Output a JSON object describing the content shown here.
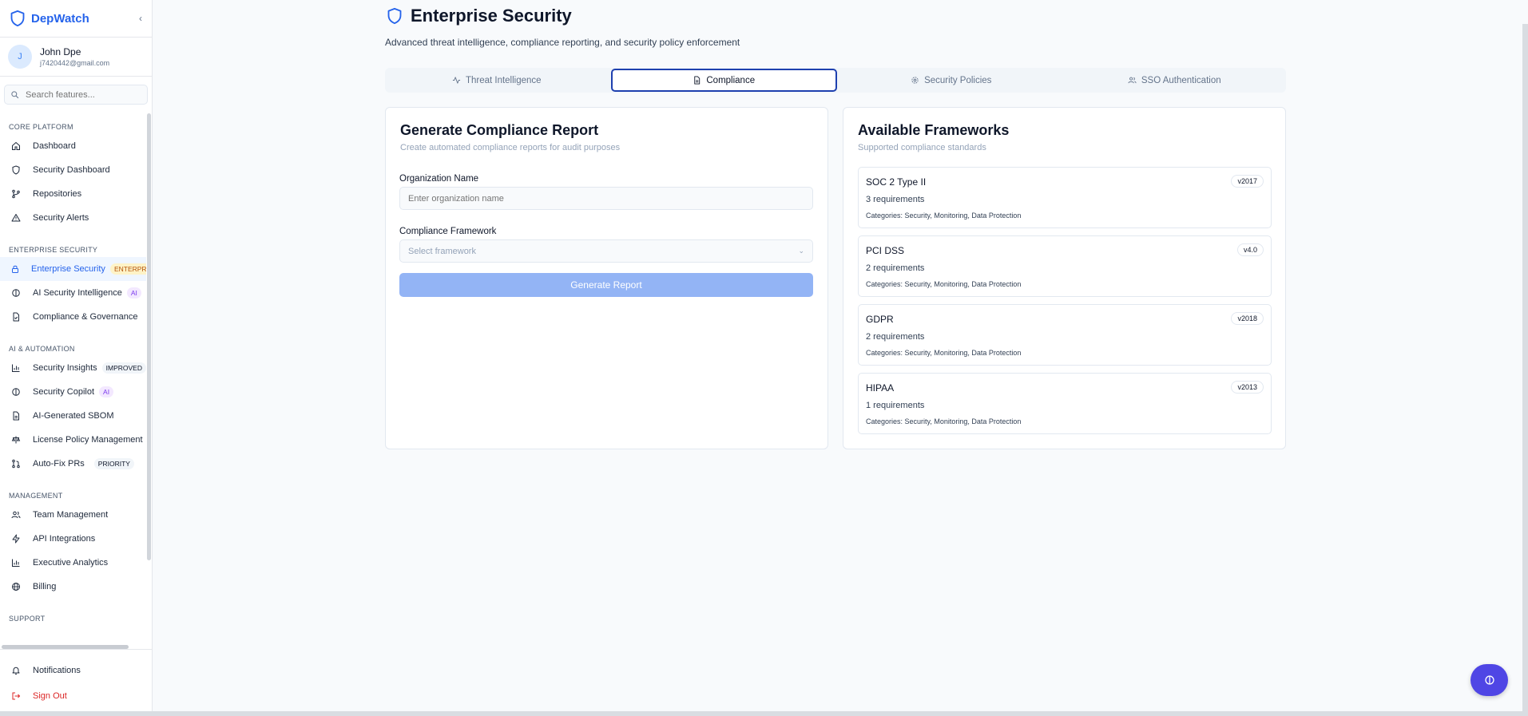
{
  "app": {
    "name": "DepWatch",
    "brand_color": "#2563eb"
  },
  "user": {
    "initial": "J",
    "name": "John Dpe",
    "email": "j7420442@gmail.com"
  },
  "search": {
    "placeholder": "Search features..."
  },
  "sidebar": {
    "sections": [
      {
        "title": "CORE PLATFORM",
        "items": [
          {
            "label": "Dashboard",
            "icon": "home-icon"
          },
          {
            "label": "Security Dashboard",
            "icon": "shield-icon"
          },
          {
            "label": "Repositories",
            "icon": "git-branch-icon"
          },
          {
            "label": "Security Alerts",
            "icon": "alert-triangle-icon"
          }
        ]
      },
      {
        "title": "ENTERPRISE SECURITY",
        "items": [
          {
            "label": "Enterprise Security",
            "icon": "lock-icon",
            "badge": "ENTERPRISE",
            "active": true
          },
          {
            "label": "AI Security Intelligence",
            "icon": "brain-icon",
            "badge": "AI"
          },
          {
            "label": "Compliance & Governance",
            "icon": "file-check-icon"
          }
        ]
      },
      {
        "title": "AI & AUTOMATION",
        "items": [
          {
            "label": "Security Insights",
            "icon": "bar-chart-icon",
            "badge": "IMPROVED"
          },
          {
            "label": "Security Copilot",
            "icon": "brain-icon",
            "badge": "AI"
          },
          {
            "label": "AI-Generated SBOM",
            "icon": "file-text-icon"
          },
          {
            "label": "License Policy Management",
            "icon": "scale-icon"
          },
          {
            "label": "Auto-Fix PRs",
            "icon": "git-pull-request-icon",
            "badge": "PRIORITY"
          }
        ]
      },
      {
        "title": "MANAGEMENT",
        "items": [
          {
            "label": "Team Management",
            "icon": "users-icon"
          },
          {
            "label": "API Integrations",
            "icon": "zap-icon"
          },
          {
            "label": "Executive Analytics",
            "icon": "bar-chart-icon"
          },
          {
            "label": "Billing",
            "icon": "globe-icon"
          }
        ]
      },
      {
        "title": "SUPPORT",
        "items": []
      }
    ],
    "bottom": {
      "notifications": "Notifications",
      "sign_out": "Sign Out"
    }
  },
  "page": {
    "title": "Enterprise Security",
    "subtitle": "Advanced threat intelligence, compliance reporting, and security policy enforcement",
    "tabs": [
      {
        "label": "Threat Intelligence",
        "icon": "activity-icon"
      },
      {
        "label": "Compliance",
        "icon": "file-text-icon",
        "active": true
      },
      {
        "label": "Security Policies",
        "icon": "gear-icon"
      },
      {
        "label": "SSO Authentication",
        "icon": "users-icon"
      }
    ]
  },
  "report": {
    "title": "Generate Compliance Report",
    "description": "Create automated compliance reports for audit purposes",
    "org_label": "Organization Name",
    "org_placeholder": "Enter organization name",
    "org_value": "",
    "framework_label": "Compliance Framework",
    "framework_placeholder": "Select framework",
    "button": "Generate Report"
  },
  "frameworks": {
    "title": "Available Frameworks",
    "description": "Supported compliance standards",
    "items": [
      {
        "name": "SOC 2 Type II",
        "version": "v2017",
        "requirements": "3 requirements",
        "categories": "Categories: Security, Monitoring, Data Protection"
      },
      {
        "name": "PCI DSS",
        "version": "v4.0",
        "requirements": "2 requirements",
        "categories": "Categories: Security, Monitoring, Data Protection"
      },
      {
        "name": "GDPR",
        "version": "v2018",
        "requirements": "2 requirements",
        "categories": "Categories: Security, Monitoring, Data Protection"
      },
      {
        "name": "HIPAA",
        "version": "v2013",
        "requirements": "1 requirements",
        "categories": "Categories: Security, Monitoring, Data Protection"
      }
    ]
  },
  "colors": {
    "accent": "#2563eb",
    "fab": "#4f46e5",
    "button_disabled": "#93b4f5",
    "danger": "#dc2626"
  }
}
